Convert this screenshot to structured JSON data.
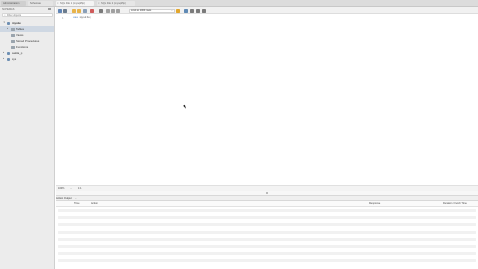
{
  "tabs": {
    "administration": "Administration",
    "schemas": "Schemas",
    "query_tabs": [
      {
        "label": "SQL File 1 (mysql/ftp)"
      },
      {
        "label": "SQL File 2 (mysql/ftp)"
      }
    ]
  },
  "sidebar": {
    "label": "SCHEMAS",
    "filter_placeholder": "Filter objects",
    "tree": [
      {
        "label": "mysite",
        "level": 0,
        "arrow": "▼",
        "kind": "db",
        "bold": true
      },
      {
        "label": "Tables",
        "level": 1,
        "arrow": "▸",
        "kind": "folder",
        "selected": true
      },
      {
        "label": "Views",
        "level": 1,
        "arrow": "",
        "kind": "folder"
      },
      {
        "label": "Stored Procedures",
        "level": 1,
        "arrow": "",
        "kind": "folder"
      },
      {
        "label": "Functions",
        "level": 1,
        "arrow": "",
        "kind": "folder"
      },
      {
        "label": "sakila_p",
        "level": 0,
        "arrow": "▸",
        "kind": "db"
      },
      {
        "label": "sys",
        "level": 0,
        "arrow": "▸",
        "kind": "db"
      }
    ]
  },
  "toolbar": {
    "limit_label": "Limit to 1000 rows",
    "icons": [
      {
        "name": "open-folder-icon",
        "color": "#5f84b5"
      },
      {
        "name": "save-icon",
        "color": "#6b7c8e"
      },
      {
        "name": "execute-icon",
        "color": "#e7b34a"
      },
      {
        "name": "execute-current-icon",
        "color": "#e7b34a"
      },
      {
        "name": "explain-icon",
        "color": "#8aa0b8"
      },
      {
        "name": "stop-icon",
        "color": "#cf5a5a"
      },
      {
        "name": "toggle-autocommit-icon",
        "color": "#7a7a7a"
      },
      {
        "name": "commit-icon",
        "color": "#a0a0a0"
      },
      {
        "name": "rollback-icon",
        "color": "#a0a0a0"
      },
      {
        "name": "beautify-icon",
        "color": "#a0a0a0"
      },
      {
        "name": "star-icon",
        "color": "#e2a62c"
      },
      {
        "name": "brush-icon",
        "color": "#5f8ab5"
      },
      {
        "name": "search-icon",
        "color": "#7a7a7a"
      },
      {
        "name": "invisible-chars-icon",
        "color": "#7a7a7a"
      },
      {
        "name": "wrap-icon",
        "color": "#7a7a7a"
      }
    ]
  },
  "editor": {
    "line_number": "1",
    "keyword": "use",
    "identifier": "mysite",
    "suffix": ";"
  },
  "status": {
    "zoom": "100%",
    "position": "1:1"
  },
  "output": {
    "selector": "Action Output",
    "columns": {
      "time": "Time",
      "action": "Action",
      "response": "Response",
      "duration": "Duration / Fetch Time"
    },
    "row_count": 8
  }
}
